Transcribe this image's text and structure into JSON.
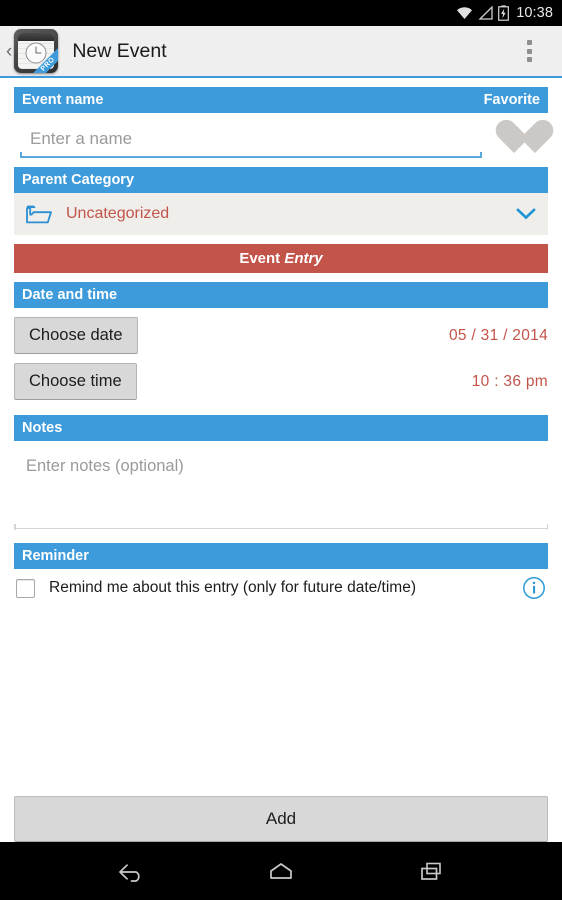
{
  "status_bar": {
    "time": "10:38",
    "icons": [
      "wifi-icon",
      "signal-icon",
      "battery-charging-icon"
    ]
  },
  "action_bar": {
    "back_glyph": "‹",
    "app_icon": "notepad-clock-app-icon",
    "app_icon_ribbon": "PRO",
    "title": "New Event",
    "overflow_icon": "overflow-menu-icon"
  },
  "event_name": {
    "header": "Event name",
    "favorite_label": "Favorite",
    "input_value": "",
    "input_placeholder": "Enter a name",
    "favorite_icon": "heart-icon",
    "favorite_active": false
  },
  "parent_category": {
    "header": "Parent Category",
    "folder_icon": "folder-icon",
    "selected": "Uncategorized",
    "chevron_icon": "chevron-down-icon"
  },
  "entry_banner": {
    "prefix": "Event ",
    "emphasis": "Entry"
  },
  "date_time": {
    "header": "Date and time",
    "choose_date_label": "Choose date",
    "date_value": "05 / 31 / 2014",
    "choose_time_label": "Choose time",
    "time_value": "10 : 36 pm"
  },
  "notes": {
    "header": "Notes",
    "value": "",
    "placeholder": "Enter notes (optional)"
  },
  "reminder": {
    "header": "Reminder",
    "checkbox_label": "Remind me about this entry (only for future date/time)",
    "checked": false,
    "info_icon": "info-icon"
  },
  "footer": {
    "add_label": "Add"
  },
  "nav_bar": {
    "back": "back-icon",
    "home": "home-icon",
    "recents": "recents-icon"
  },
  "colors": {
    "section_blue": "#3d9bdb",
    "entry_red": "#c2544a",
    "value_red": "#c2544a",
    "category_bg": "#efeeea",
    "button_gray": "#d8d8d8"
  }
}
